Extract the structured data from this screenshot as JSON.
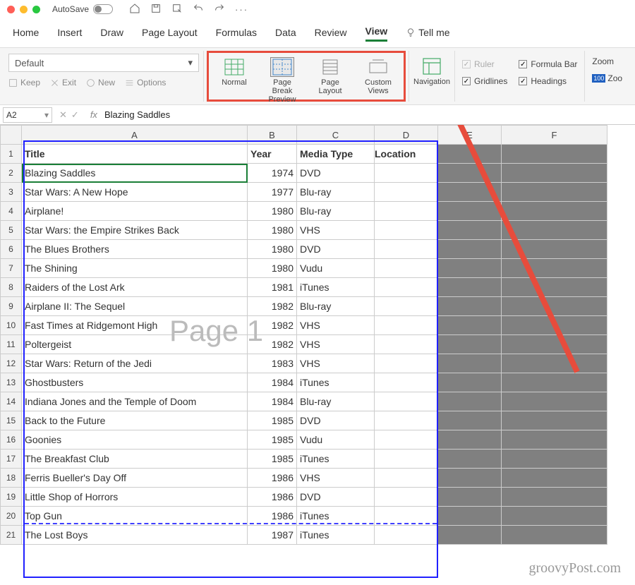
{
  "titlebar": {
    "autosave": "AutoSave"
  },
  "tabs": [
    "Home",
    "Insert",
    "Draw",
    "Page Layout",
    "Formulas",
    "Data",
    "Review",
    "View",
    "Tell me"
  ],
  "active_tab": "View",
  "ribbon": {
    "style_combo": "Default",
    "smallbtns": [
      "Keep",
      "Exit",
      "New",
      "Options"
    ],
    "viewbtns": [
      {
        "label": "Normal"
      },
      {
        "label": "Page Break Preview"
      },
      {
        "label": "Page Layout"
      },
      {
        "label": "Custom Views"
      }
    ],
    "navigation": "Navigation",
    "checks": {
      "ruler": "Ruler",
      "gridlines": "Gridlines",
      "formula": "Formula Bar",
      "headings": "Headings"
    },
    "zoom": "Zoom",
    "zoom100": "Zoo",
    "z100": "100"
  },
  "formula": {
    "cellref": "A2",
    "value": "Blazing Saddles"
  },
  "columns": [
    "A",
    "B",
    "C",
    "D",
    "E",
    "F"
  ],
  "headers": {
    "A": "Title",
    "B": "Year",
    "C": "Media Type",
    "D": "Location"
  },
  "rows": [
    {
      "n": 1
    },
    {
      "n": 2,
      "A": "Blazing Saddles",
      "B": "1974",
      "C": "DVD"
    },
    {
      "n": 3,
      "A": "Star Wars: A New Hope",
      "B": "1977",
      "C": "Blu-ray"
    },
    {
      "n": 4,
      "A": "Airplane!",
      "B": "1980",
      "C": "Blu-ray"
    },
    {
      "n": 5,
      "A": "Star Wars: the Empire Strikes Back",
      "B": "1980",
      "C": "VHS"
    },
    {
      "n": 6,
      "A": "The Blues Brothers",
      "B": "1980",
      "C": "DVD"
    },
    {
      "n": 7,
      "A": "The Shining",
      "B": "1980",
      "C": "Vudu"
    },
    {
      "n": 8,
      "A": "Raiders of the Lost Ark",
      "B": "1981",
      "C": "iTunes"
    },
    {
      "n": 9,
      "A": "Airplane II: The Sequel",
      "B": "1982",
      "C": "Blu-ray"
    },
    {
      "n": 10,
      "A": "Fast Times at Ridgemont High",
      "B": "1982",
      "C": "VHS"
    },
    {
      "n": 11,
      "A": "Poltergeist",
      "B": "1982",
      "C": "VHS"
    },
    {
      "n": 12,
      "A": "Star Wars: Return of the Jedi",
      "B": "1983",
      "C": "VHS"
    },
    {
      "n": 13,
      "A": "Ghostbusters",
      "B": "1984",
      "C": "iTunes"
    },
    {
      "n": 14,
      "A": "Indiana Jones and the Temple of Doom",
      "B": "1984",
      "C": "Blu-ray"
    },
    {
      "n": 15,
      "A": "Back to the Future",
      "B": "1985",
      "C": "DVD"
    },
    {
      "n": 16,
      "A": "Goonies",
      "B": "1985",
      "C": "Vudu"
    },
    {
      "n": 17,
      "A": "The Breakfast Club",
      "B": "1985",
      "C": "iTunes"
    },
    {
      "n": 18,
      "A": "Ferris Bueller's Day Off",
      "B": "1986",
      "C": "VHS"
    },
    {
      "n": 19,
      "A": "Little Shop of Horrors",
      "B": "1986",
      "C": "DVD"
    },
    {
      "n": 20,
      "A": "Top Gun",
      "B": "1986",
      "C": "iTunes"
    },
    {
      "n": 21,
      "A": "The Lost Boys",
      "B": "1987",
      "C": "iTunes"
    }
  ],
  "watermark_page": "Page 1",
  "site": "groovyPost.com"
}
